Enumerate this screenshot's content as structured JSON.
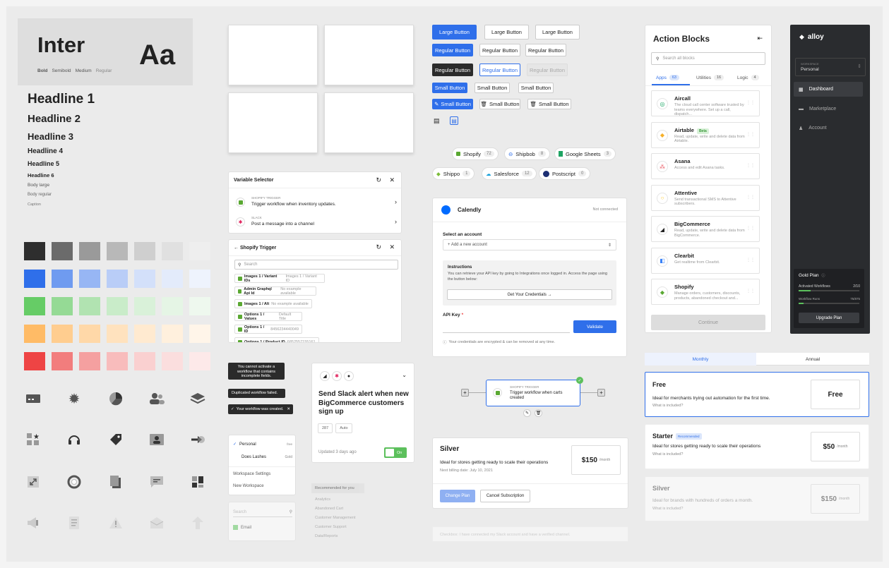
{
  "typography": {
    "font_name": "Inter",
    "sample": "Aa",
    "weights": [
      "Bold",
      "Semibold",
      "Medium",
      "Regular"
    ],
    "headlines": [
      "Headline 1",
      "Headline 2",
      "Headline 3",
      "Headline 4",
      "Headline 5",
      "Headline 6"
    ],
    "body": [
      "Body large",
      "Body regular",
      "Caption"
    ]
  },
  "palette": {
    "rows": [
      [
        "#2e2e2e",
        "#6b6b6b",
        "#9a9a9a",
        "#b8b8b8",
        "#cfcfcf",
        "#e0e0e0",
        "#eeeeee"
      ],
      [
        "#2f6fea",
        "#6f9bf0",
        "#97b6f4",
        "#b9cdf7",
        "#d3e0fa",
        "#e3ebfb",
        "#eef3fd"
      ],
      [
        "#66cc66",
        "#95da95",
        "#b1e3b1",
        "#c9ecc9",
        "#d9f1d9",
        "#e5f5e5",
        "#eef8ee"
      ],
      [
        "#ffbb66",
        "#ffcd8f",
        "#ffd8a8",
        "#ffe2be",
        "#ffead0",
        "#fff0dd",
        "#fff5e9"
      ],
      [
        "#ee4444",
        "#f27d7d",
        "#f5a0a0",
        "#f8bcbc",
        "#fad0d0",
        "#fbdede",
        "#fde9e9"
      ]
    ]
  },
  "icons": [
    "credit-card-icon",
    "badge-star-icon",
    "pie-chart-icon",
    "users-icon",
    "layers-icon",
    "apps-star-icon",
    "headset-icon",
    "tag-icon",
    "contact-card-icon",
    "integration-icon",
    "expand-icon",
    "lifebuoy-icon",
    "copy-icon",
    "message-icon",
    "dashboard-icon",
    "megaphone-icon",
    "document-icon",
    "warning-icon",
    "mail-open-icon",
    "upload-icon"
  ],
  "buttons": {
    "large": "Large Button",
    "regular": "Regular Button",
    "small": "Small Button"
  },
  "app_chips": [
    {
      "name": "Shopify",
      "count": "72"
    },
    {
      "name": "Shipbob",
      "count": "8"
    },
    {
      "name": "Google Sheets",
      "count": "3"
    },
    {
      "name": "Shippo",
      "count": "1"
    },
    {
      "name": "Salesforce",
      "count": "12"
    },
    {
      "name": "Postscript",
      "count": "0"
    }
  ],
  "variable_selector": {
    "title": "Variable Selector",
    "items": [
      {
        "app": "SHOPIFY TRIGGER",
        "text": "Trigger workflow when inventory updates."
      },
      {
        "app": "SLACK",
        "text": "Post a message into a channel"
      }
    ]
  },
  "shopify_trigger": {
    "title": "← Shopify Trigger",
    "search": "Search",
    "rows": [
      {
        "label": "Images 1 / Variant IDs",
        "value": "Images 1 / Variant ID"
      },
      {
        "label": "Admin Graphql Api Id",
        "value": "No example available"
      },
      {
        "label": "Images 1 / Alt",
        "value": "No example available"
      },
      {
        "label": "Options 1 / Values",
        "value": "Default Title"
      },
      {
        "label": "Options 1 / ID",
        "value": "8456234440049"
      },
      {
        "label": "Options 1 / Product ID",
        "value": "6852557155161"
      }
    ]
  },
  "toasts": [
    "You cannot activate a workflow that contains incomplete fields.",
    "Duplicated workflow failed.",
    "Your workflow was created."
  ],
  "workspace_menu": {
    "items": [
      {
        "label": "Personal",
        "badge": "free"
      },
      {
        "label": "Does Lashes",
        "badge": "Gold"
      }
    ],
    "settings": "Workspace Settings",
    "new": "New Workspace"
  },
  "search_list": {
    "placeholder": "Search",
    "item": "Email"
  },
  "recipe_card": {
    "title": "Send Slack alert when new BigCommerce customers sign up",
    "tags": [
      "287",
      "Auto"
    ],
    "updated": "Updated 3 days ago",
    "toggle": "On"
  },
  "recommended": {
    "header": "Recommended for you",
    "items": [
      "Analytics",
      "Abandoned Cart",
      "Customer Management",
      "Customer Support",
      "Data/Reports"
    ]
  },
  "calendly": {
    "title": "Calendly",
    "status": "Not connected",
    "select_label": "Select an account",
    "add_account": "+ Add a new account",
    "instructions_title": "Instructions",
    "instructions_text": "You can retrieve your API key by going to Integrations once logged in. Access the page using the button below:",
    "credentials_btn": "Get Your Credentials →",
    "api_key_label": "API Key",
    "validate": "Validate",
    "note": "Your credentials are encrypted & can be removed at any time."
  },
  "workflow_node": {
    "app": "SHOPIFY TRIGGER",
    "text": "Trigger workflow when carts created"
  },
  "silver_plan": {
    "name": "Silver",
    "desc": "Ideal for stores getting ready to scale their operations",
    "billing": "Next billing date: July 10, 2021",
    "price": "$150",
    "period": "/month",
    "change": "Change Plan",
    "cancel": "Cancel Subscription"
  },
  "action_blocks": {
    "title": "Action Blocks",
    "search": "Search all blocks",
    "tabs": [
      {
        "label": "Apps",
        "count": "63"
      },
      {
        "label": "Utilities",
        "count": "16"
      },
      {
        "label": "Logic",
        "count": "4"
      }
    ],
    "items": [
      {
        "name": "Aircall",
        "desc": "The cloud call center software trusted by teams everywhere. Set up a call, dispatch...",
        "logo": "#1aa664",
        "letter": "◎"
      },
      {
        "name": "Airtable",
        "badge": "Beta",
        "desc": "Read, update, write and delete data from Airtable.",
        "logo": "#f6b02a",
        "letter": "◆"
      },
      {
        "name": "Asana",
        "desc": "Access and edit Asana tasks.",
        "logo": "#e8505b",
        "letter": "⁂"
      },
      {
        "name": "Attentive",
        "desc": "Send transactional SMS to Attentive subscribers.",
        "logo": "#ffcc33",
        "letter": "○"
      },
      {
        "name": "BigCommerce",
        "desc": "Read, update, write and delete data from BigCommerce.",
        "logo": "#222222",
        "letter": "◢"
      },
      {
        "name": "Clearbit",
        "desc": "Get realtime from Clearbit.",
        "logo": "#3a82f7",
        "letter": "◧"
      },
      {
        "name": "Shopify",
        "desc": "Manage orders, customers, discounts, products, abandoned checkout and...",
        "logo": "#5aa832",
        "letter": "◆"
      }
    ],
    "continue": "Continue"
  },
  "sidebar": {
    "brand": "alloy",
    "workspace_label": "WORKSPACE",
    "workspace": "Personal",
    "nav": [
      "Dashboard",
      "Marketplace",
      "Account"
    ],
    "plan": "Gold Plan",
    "metric1": "Activated Workflows",
    "metric1_val": "2/10",
    "metric2": "Workflow Runs",
    "metric2_val": "75/875",
    "upgrade": "Upgrade Plan"
  },
  "pricing": {
    "tabs": [
      "Monthly",
      "Annual"
    ],
    "plans": [
      {
        "name": "Free",
        "desc": "Ideal for merchants trying out automation for the first time.",
        "link": "What is included?",
        "price": "Free",
        "period": ""
      },
      {
        "name": "Starter",
        "badge": "Recommended",
        "desc": "Ideal for stores getting ready to scale their operations",
        "link": "What is included?",
        "price": "$50",
        "period": "/month"
      },
      {
        "name": "Silver",
        "desc": "Ideal for brands with hundreds of orders a month.",
        "link": "What is included?",
        "price": "$150",
        "period": "/month"
      }
    ]
  },
  "disabled_note": "Checkbox: I have connected my Slack account and have a verified channel."
}
